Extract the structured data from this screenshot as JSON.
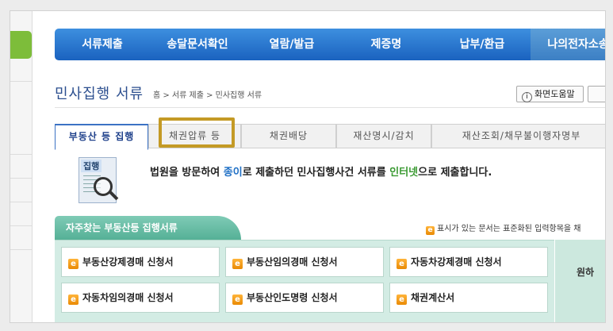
{
  "nav": {
    "items": [
      "서류제출",
      "송달문서확인",
      "열람/발급",
      "제증명",
      "납부/환급",
      "나의전자소송"
    ]
  },
  "header": {
    "title": "민사집행 서류",
    "breadcrumb": "홈 > 서류 제출 > 민사집행 서류",
    "help_label": "화면도움말",
    "help_icon": "info-icon"
  },
  "tabs": [
    {
      "label": "부동산 등 집행",
      "active": true
    },
    {
      "label": "채권압류 등",
      "active": false
    },
    {
      "label": "채권배당",
      "active": false
    },
    {
      "label": "재산명시/감치",
      "active": false
    },
    {
      "label": "재산조회/채무불이행자명부",
      "active": false
    }
  ],
  "intro": {
    "icon_label": "집행",
    "part1": "법원을 방문하여 ",
    "part2": "종이",
    "part3": "로 제출하던 민사집행사건 서류를 ",
    "part4": "인터넷",
    "part5": "으로 제출합니다."
  },
  "panel": {
    "title": "자주찾는 부동산등 집행서류",
    "note": "표시가 있는 문서는 표준화된 입력항목을 채",
    "right_text": "원하",
    "docs": [
      "부동산강제경매 신청서",
      "부동산임의경매 신청서",
      "자동차강제경매 신청서",
      "자동차임의경매 신청서",
      "부동산인도명령 신청서",
      "채권계산서"
    ]
  },
  "colors": {
    "nav_bg": "#1a62bf",
    "highlight_border": "#c49a25",
    "panel_bg": "#d3ece4",
    "panel_header": "#55b096",
    "accent_blue": "#1e6fc5",
    "accent_green": "#3a9a32"
  }
}
